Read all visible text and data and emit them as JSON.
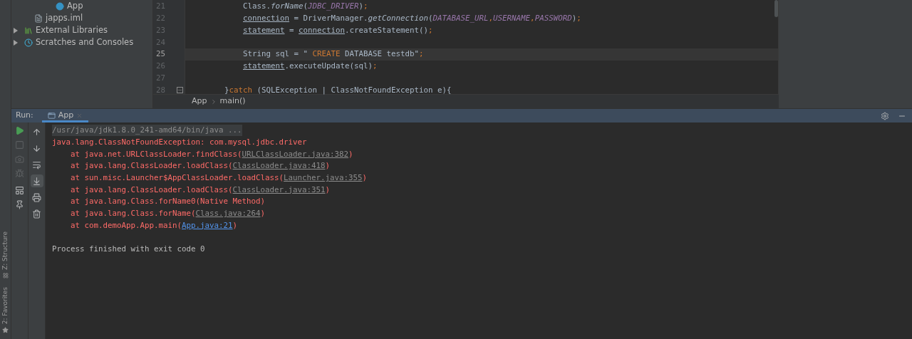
{
  "project_tree": [
    {
      "label": "App",
      "kind": "class"
    },
    {
      "label": "japps.iml",
      "kind": "file"
    },
    {
      "label": "External Libraries",
      "kind": "library",
      "expanded": false
    },
    {
      "label": "Scratches and Consoles",
      "kind": "scratch",
      "expanded": false
    }
  ],
  "editor": {
    "lines": [
      {
        "number": "21",
        "kind": "statement",
        "current": false,
        "fold": false,
        "tokens": [
          {
            "text": "Class.",
            "kind": "plain"
          },
          {
            "text": "forName",
            "kind": "method"
          },
          {
            "text": "(",
            "kind": "plain"
          },
          {
            "text": "JDBC_DRIVER",
            "kind": "constant"
          },
          {
            "text": ")",
            "kind": "plain"
          },
          {
            "text": ";",
            "kind": "keyword"
          }
        ]
      },
      {
        "number": "22",
        "kind": "statement",
        "current": false,
        "fold": false,
        "tokens": [
          {
            "text": "connection",
            "kind": "field"
          },
          {
            "text": " = DriverManager.",
            "kind": "plain"
          },
          {
            "text": "getConnection",
            "kind": "method"
          },
          {
            "text": "(",
            "kind": "plain"
          },
          {
            "text": "DATABASE_URL",
            "kind": "constant"
          },
          {
            "text": ",",
            "kind": "keyword"
          },
          {
            "text": "USERNAME",
            "kind": "constant"
          },
          {
            "text": ",",
            "kind": "keyword"
          },
          {
            "text": "PASSWORD",
            "kind": "constant"
          },
          {
            "text": ")",
            "kind": "plain"
          },
          {
            "text": ";",
            "kind": "keyword"
          }
        ]
      },
      {
        "number": "23",
        "kind": "statement",
        "current": false,
        "fold": false,
        "tokens": [
          {
            "text": "statement",
            "kind": "field"
          },
          {
            "text": " = ",
            "kind": "plain"
          },
          {
            "text": "connection",
            "kind": "field"
          },
          {
            "text": ".createStatement()",
            "kind": "plain"
          },
          {
            "text": ";",
            "kind": "keyword"
          }
        ]
      },
      {
        "number": "24",
        "kind": "blank",
        "current": false,
        "fold": false
      },
      {
        "number": "25",
        "kind": "statement",
        "current": true,
        "fold": false,
        "tokens": [
          {
            "text": "String sql = \" ",
            "kind": "plain"
          },
          {
            "text": "CREATE",
            "kind": "keyword"
          },
          {
            "text": " DATABASE testdb\"",
            "kind": "plain"
          },
          {
            "text": ";",
            "kind": "keyword"
          }
        ]
      },
      {
        "number": "26",
        "kind": "statement",
        "current": false,
        "fold": false,
        "tokens": [
          {
            "text": "statement",
            "kind": "field"
          },
          {
            "text": ".executeUpdate(sql)",
            "kind": "plain"
          },
          {
            "text": ";",
            "kind": "keyword"
          }
        ]
      },
      {
        "number": "27",
        "kind": "blank",
        "current": false,
        "fold": false
      },
      {
        "number": "28",
        "kind": "closing",
        "current": false,
        "fold": true,
        "tokens": [
          {
            "text": "}",
            "kind": "plain"
          },
          {
            "text": "catch ",
            "kind": "keyword"
          },
          {
            "text": "(SQLException | ClassNotFoundException e){",
            "kind": "plain"
          }
        ]
      }
    ]
  },
  "breadcrumbs": [
    "App",
    "main()"
  ],
  "run_panel": {
    "label": "Run:",
    "tabs": [
      {
        "label": "App",
        "selected": true
      }
    ],
    "left_tools": [
      {
        "disabled": false
      },
      {
        "disabled": true
      },
      {
        "disabled": true
      },
      {
        "disabled": true
      },
      {
        "disabled": false
      },
      {
        "disabled": false
      }
    ],
    "right_tools": [
      {
        "selected": false
      },
      {
        "selected": false
      },
      {
        "selected": false
      },
      {
        "selected": true
      },
      {
        "selected": false
      },
      {
        "selected": false
      }
    ],
    "console": [
      {
        "kind": "command",
        "parts": [
          {
            "text": "/usr/java/jdk1.8.0_241-amd64/bin/java ...",
            "kind": "command"
          }
        ]
      },
      {
        "kind": "error",
        "parts": [
          {
            "text": "java.lang.ClassNotFoundException: com.mysql.jdbc.driver",
            "kind": "error"
          }
        ]
      },
      {
        "kind": "trace",
        "parts": [
          {
            "text": "at java.net.URLClassLoader.findClass(",
            "kind": "error"
          },
          {
            "text": "URLClassLoader.java:382",
            "kind": "link"
          },
          {
            "text": ")",
            "kind": "error"
          }
        ]
      },
      {
        "kind": "trace",
        "parts": [
          {
            "text": "at java.lang.ClassLoader.loadClass(",
            "kind": "error"
          },
          {
            "text": "ClassLoader.java:418",
            "kind": "link"
          },
          {
            "text": ")",
            "kind": "error"
          }
        ]
      },
      {
        "kind": "trace",
        "parts": [
          {
            "text": "at sun.misc.Launcher$AppClassLoader.loadClass(",
            "kind": "error"
          },
          {
            "text": "Launcher.java:355",
            "kind": "link"
          },
          {
            "text": ")",
            "kind": "error"
          }
        ]
      },
      {
        "kind": "trace",
        "parts": [
          {
            "text": "at java.lang.ClassLoader.loadClass(",
            "kind": "error"
          },
          {
            "text": "ClassLoader.java:351",
            "kind": "link"
          },
          {
            "text": ")",
            "kind": "error"
          }
        ]
      },
      {
        "kind": "trace",
        "parts": [
          {
            "text": "at java.lang.Class.forName0(Native Method)",
            "kind": "error"
          }
        ]
      },
      {
        "kind": "trace",
        "parts": [
          {
            "text": "at java.lang.Class.forName(",
            "kind": "error"
          },
          {
            "text": "Class.java:264",
            "kind": "link"
          },
          {
            "text": ")",
            "kind": "error"
          }
        ]
      },
      {
        "kind": "trace",
        "parts": [
          {
            "text": "at com.demoApp.App.main(",
            "kind": "error"
          },
          {
            "text": "App.java:21",
            "kind": "source-link"
          },
          {
            "text": ")",
            "kind": "error"
          }
        ]
      },
      {
        "kind": "info",
        "parts": [
          {
            "text": "Process finished with exit code 0",
            "kind": "info"
          }
        ]
      }
    ]
  },
  "side_tabs": [
    "Z: Structure",
    "2: Favorites"
  ]
}
